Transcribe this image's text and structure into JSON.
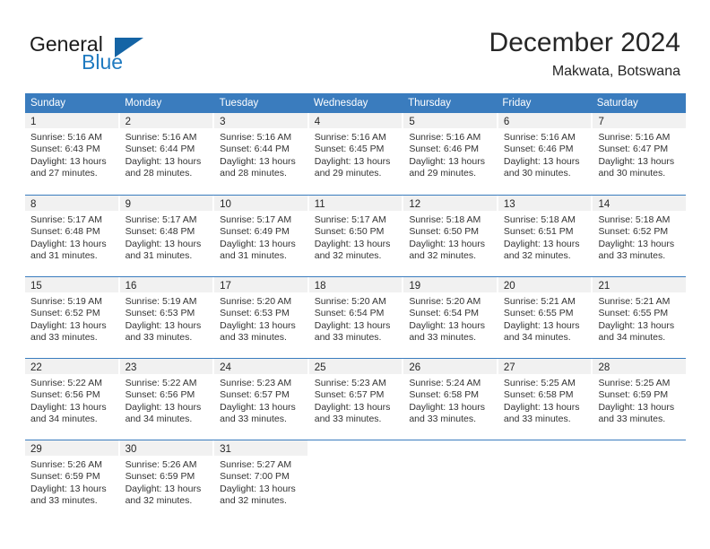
{
  "logo": {
    "word1": "General",
    "word2": "Blue",
    "triangle_color": "#1464a5",
    "blue_text_color": "#1f7ac0"
  },
  "header": {
    "title": "December 2024",
    "location": "Makwata, Botswana"
  },
  "theme": {
    "header_blue": "#3a7cbe",
    "daynum_band": "#f1f1f1",
    "text": "#333333"
  },
  "weekdays": [
    "Sunday",
    "Monday",
    "Tuesday",
    "Wednesday",
    "Thursday",
    "Friday",
    "Saturday"
  ],
  "weeks": [
    [
      {
        "day": "1",
        "sunrise": "Sunrise: 5:16 AM",
        "sunset": "Sunset: 6:43 PM",
        "daylight1": "Daylight: 13 hours",
        "daylight2": "and 27 minutes."
      },
      {
        "day": "2",
        "sunrise": "Sunrise: 5:16 AM",
        "sunset": "Sunset: 6:44 PM",
        "daylight1": "Daylight: 13 hours",
        "daylight2": "and 28 minutes."
      },
      {
        "day": "3",
        "sunrise": "Sunrise: 5:16 AM",
        "sunset": "Sunset: 6:44 PM",
        "daylight1": "Daylight: 13 hours",
        "daylight2": "and 28 minutes."
      },
      {
        "day": "4",
        "sunrise": "Sunrise: 5:16 AM",
        "sunset": "Sunset: 6:45 PM",
        "daylight1": "Daylight: 13 hours",
        "daylight2": "and 29 minutes."
      },
      {
        "day": "5",
        "sunrise": "Sunrise: 5:16 AM",
        "sunset": "Sunset: 6:46 PM",
        "daylight1": "Daylight: 13 hours",
        "daylight2": "and 29 minutes."
      },
      {
        "day": "6",
        "sunrise": "Sunrise: 5:16 AM",
        "sunset": "Sunset: 6:46 PM",
        "daylight1": "Daylight: 13 hours",
        "daylight2": "and 30 minutes."
      },
      {
        "day": "7",
        "sunrise": "Sunrise: 5:16 AM",
        "sunset": "Sunset: 6:47 PM",
        "daylight1": "Daylight: 13 hours",
        "daylight2": "and 30 minutes."
      }
    ],
    [
      {
        "day": "8",
        "sunrise": "Sunrise: 5:17 AM",
        "sunset": "Sunset: 6:48 PM",
        "daylight1": "Daylight: 13 hours",
        "daylight2": "and 31 minutes."
      },
      {
        "day": "9",
        "sunrise": "Sunrise: 5:17 AM",
        "sunset": "Sunset: 6:48 PM",
        "daylight1": "Daylight: 13 hours",
        "daylight2": "and 31 minutes."
      },
      {
        "day": "10",
        "sunrise": "Sunrise: 5:17 AM",
        "sunset": "Sunset: 6:49 PM",
        "daylight1": "Daylight: 13 hours",
        "daylight2": "and 31 minutes."
      },
      {
        "day": "11",
        "sunrise": "Sunrise: 5:17 AM",
        "sunset": "Sunset: 6:50 PM",
        "daylight1": "Daylight: 13 hours",
        "daylight2": "and 32 minutes."
      },
      {
        "day": "12",
        "sunrise": "Sunrise: 5:18 AM",
        "sunset": "Sunset: 6:50 PM",
        "daylight1": "Daylight: 13 hours",
        "daylight2": "and 32 minutes."
      },
      {
        "day": "13",
        "sunrise": "Sunrise: 5:18 AM",
        "sunset": "Sunset: 6:51 PM",
        "daylight1": "Daylight: 13 hours",
        "daylight2": "and 32 minutes."
      },
      {
        "day": "14",
        "sunrise": "Sunrise: 5:18 AM",
        "sunset": "Sunset: 6:52 PM",
        "daylight1": "Daylight: 13 hours",
        "daylight2": "and 33 minutes."
      }
    ],
    [
      {
        "day": "15",
        "sunrise": "Sunrise: 5:19 AM",
        "sunset": "Sunset: 6:52 PM",
        "daylight1": "Daylight: 13 hours",
        "daylight2": "and 33 minutes."
      },
      {
        "day": "16",
        "sunrise": "Sunrise: 5:19 AM",
        "sunset": "Sunset: 6:53 PM",
        "daylight1": "Daylight: 13 hours",
        "daylight2": "and 33 minutes."
      },
      {
        "day": "17",
        "sunrise": "Sunrise: 5:20 AM",
        "sunset": "Sunset: 6:53 PM",
        "daylight1": "Daylight: 13 hours",
        "daylight2": "and 33 minutes."
      },
      {
        "day": "18",
        "sunrise": "Sunrise: 5:20 AM",
        "sunset": "Sunset: 6:54 PM",
        "daylight1": "Daylight: 13 hours",
        "daylight2": "and 33 minutes."
      },
      {
        "day": "19",
        "sunrise": "Sunrise: 5:20 AM",
        "sunset": "Sunset: 6:54 PM",
        "daylight1": "Daylight: 13 hours",
        "daylight2": "and 33 minutes."
      },
      {
        "day": "20",
        "sunrise": "Sunrise: 5:21 AM",
        "sunset": "Sunset: 6:55 PM",
        "daylight1": "Daylight: 13 hours",
        "daylight2": "and 34 minutes."
      },
      {
        "day": "21",
        "sunrise": "Sunrise: 5:21 AM",
        "sunset": "Sunset: 6:55 PM",
        "daylight1": "Daylight: 13 hours",
        "daylight2": "and 34 minutes."
      }
    ],
    [
      {
        "day": "22",
        "sunrise": "Sunrise: 5:22 AM",
        "sunset": "Sunset: 6:56 PM",
        "daylight1": "Daylight: 13 hours",
        "daylight2": "and 34 minutes."
      },
      {
        "day": "23",
        "sunrise": "Sunrise: 5:22 AM",
        "sunset": "Sunset: 6:56 PM",
        "daylight1": "Daylight: 13 hours",
        "daylight2": "and 34 minutes."
      },
      {
        "day": "24",
        "sunrise": "Sunrise: 5:23 AM",
        "sunset": "Sunset: 6:57 PM",
        "daylight1": "Daylight: 13 hours",
        "daylight2": "and 33 minutes."
      },
      {
        "day": "25",
        "sunrise": "Sunrise: 5:23 AM",
        "sunset": "Sunset: 6:57 PM",
        "daylight1": "Daylight: 13 hours",
        "daylight2": "and 33 minutes."
      },
      {
        "day": "26",
        "sunrise": "Sunrise: 5:24 AM",
        "sunset": "Sunset: 6:58 PM",
        "daylight1": "Daylight: 13 hours",
        "daylight2": "and 33 minutes."
      },
      {
        "day": "27",
        "sunrise": "Sunrise: 5:25 AM",
        "sunset": "Sunset: 6:58 PM",
        "daylight1": "Daylight: 13 hours",
        "daylight2": "and 33 minutes."
      },
      {
        "day": "28",
        "sunrise": "Sunrise: 5:25 AM",
        "sunset": "Sunset: 6:59 PM",
        "daylight1": "Daylight: 13 hours",
        "daylight2": "and 33 minutes."
      }
    ],
    [
      {
        "day": "29",
        "sunrise": "Sunrise: 5:26 AM",
        "sunset": "Sunset: 6:59 PM",
        "daylight1": "Daylight: 13 hours",
        "daylight2": "and 33 minutes."
      },
      {
        "day": "30",
        "sunrise": "Sunrise: 5:26 AM",
        "sunset": "Sunset: 6:59 PM",
        "daylight1": "Daylight: 13 hours",
        "daylight2": "and 32 minutes."
      },
      {
        "day": "31",
        "sunrise": "Sunrise: 5:27 AM",
        "sunset": "Sunset: 7:00 PM",
        "daylight1": "Daylight: 13 hours",
        "daylight2": "and 32 minutes."
      },
      {
        "day": "",
        "sunrise": "",
        "sunset": "",
        "daylight1": "",
        "daylight2": ""
      },
      {
        "day": "",
        "sunrise": "",
        "sunset": "",
        "daylight1": "",
        "daylight2": ""
      },
      {
        "day": "",
        "sunrise": "",
        "sunset": "",
        "daylight1": "",
        "daylight2": ""
      },
      {
        "day": "",
        "sunrise": "",
        "sunset": "",
        "daylight1": "",
        "daylight2": ""
      }
    ]
  ]
}
